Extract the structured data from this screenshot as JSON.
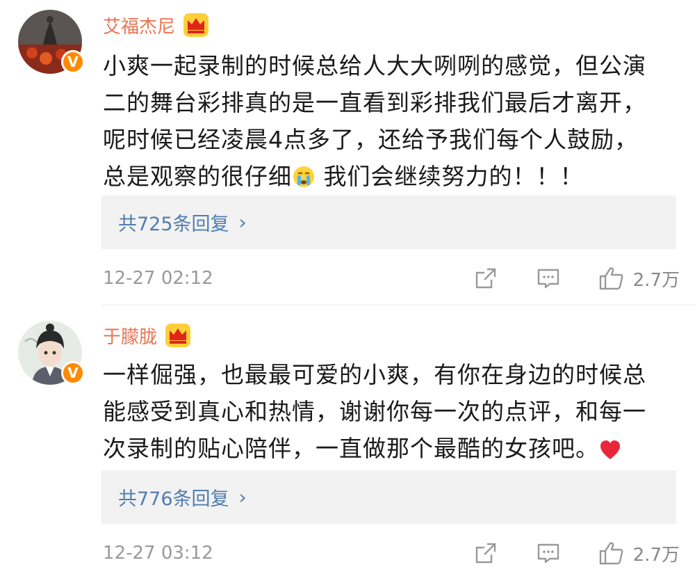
{
  "comments": [
    {
      "username": "艾福杰尼",
      "lines": [
        "小爽一起录制的时候总给人大大咧咧的感觉，但公演",
        "二的舞台彩排真的是一直看到彩排我们最后才离开，",
        "呢时候已经凌晨4点多了，还给予我们每个人鼓励，"
      ],
      "last_line_before_emoji": "总是观察的很仔细",
      "last_line_after_emoji": " 我们会继续努力的！！！",
      "emoji": "crying-face-emoji",
      "replies_label": "共725条回复",
      "time": "12-27 02:12",
      "likes": "2.7万"
    },
    {
      "username": "于朦胧",
      "lines": [
        "一样倔强，也最最可爱的小爽，有你在身边的时候总",
        "能感受到真心和热情，谢谢你每一次的点评，和每一"
      ],
      "last_line_before_emoji": "次录制的贴心陪伴，一直做那个最酷的女孩吧。",
      "last_line_after_emoji": "",
      "emoji": "red-heart-emoji",
      "replies_label": "共776条回复",
      "time": "12-27 03:12",
      "likes": "2.7万"
    }
  ],
  "colors": {
    "username": "#eb7350",
    "link": "#507daf",
    "meta": "#999999",
    "badge": "#ff8a00"
  }
}
